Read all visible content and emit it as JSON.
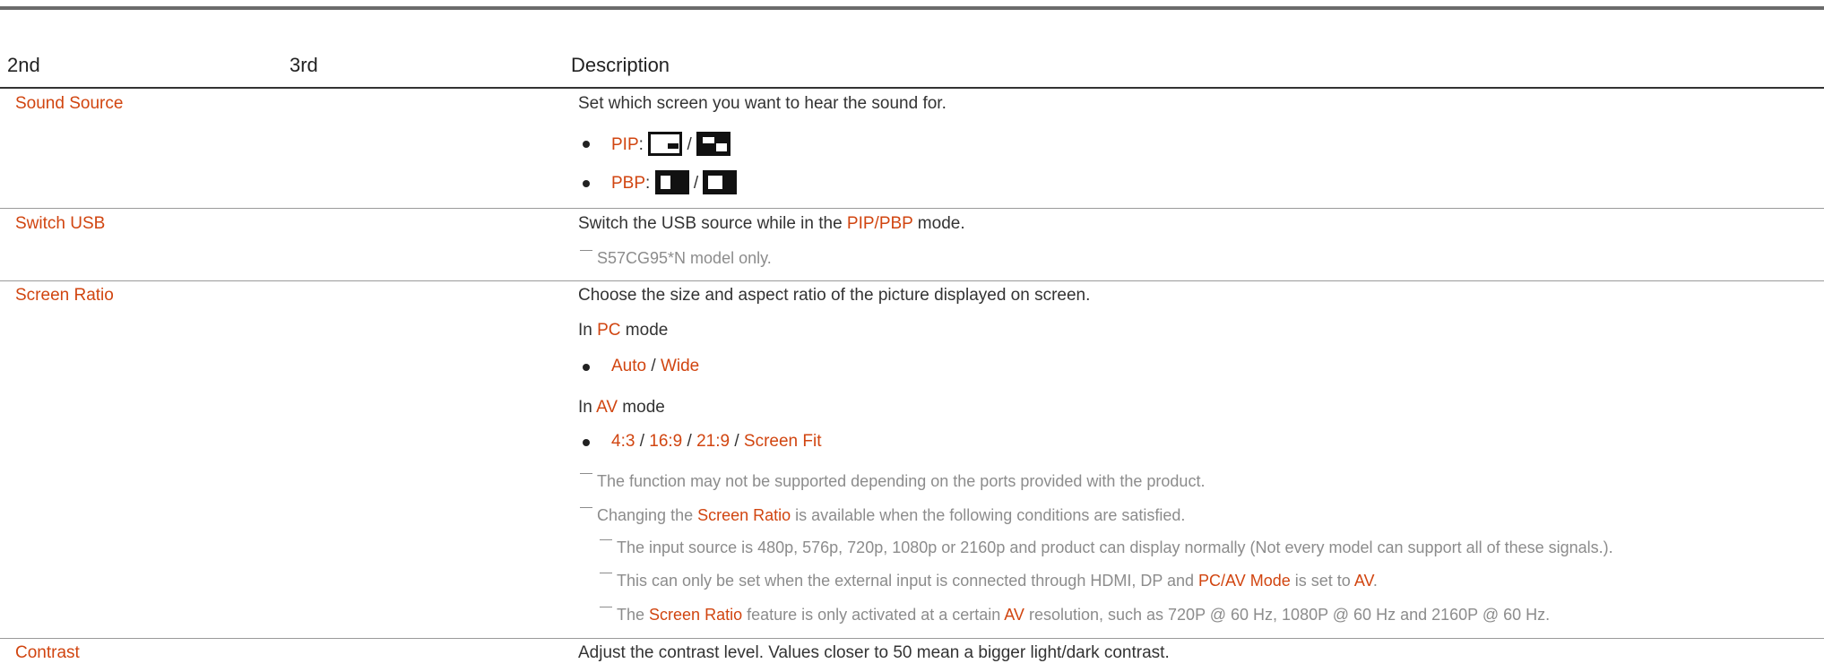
{
  "table": {
    "headers": {
      "col2": "2nd",
      "col3": "3rd",
      "desc": "Description"
    },
    "sound_source": {
      "label": "Sound Source",
      "desc": "Set which screen you want to hear the sound for.",
      "pip_label": "PIP",
      "pbp_label": "PBP",
      "colon": ":",
      "slash": "/",
      "icons": [
        "pip-small-window-icon",
        "pip-large-window-icon",
        "pbp-left-window-icon",
        "pbp-right-window-icon"
      ]
    },
    "switch_usb": {
      "label": "Switch USB",
      "desc_before": "Switch the USB source while in the ",
      "desc_mode": "PIP/PBP",
      "desc_after": " mode.",
      "note": "S57CG95*N model only."
    },
    "screen_ratio": {
      "label": "Screen Ratio",
      "desc": "Choose the size and aspect ratio of the picture displayed on screen.",
      "pc_in": "In ",
      "pc_mode_name": "PC",
      "pc_mode": " mode",
      "pc_options": [
        "Auto",
        "Wide"
      ],
      "av_in": "In ",
      "av_mode_name": "AV",
      "av_mode": " mode",
      "av_options": [
        "4:3",
        "16:9",
        "21:9",
        "Screen Fit"
      ],
      "note1": "The function may not be supported depending on the ports provided with the product.",
      "note2_before": "Changing the ",
      "note2_highlight": "Screen Ratio",
      "note2_after": " is available when the following conditions are satisfied.",
      "sub1": "The input source is 480p, 576p, 720p, 1080p or 2160p and product can display normally (Not every model can support all of these signals.).",
      "sub2_before": "This can only be set when the external input is connected through HDMI, DP and ",
      "sub2_highlight": "PC/AV Mode",
      "sub2_mid": " is set to ",
      "sub2_value": "AV",
      "sub2_end": ".",
      "sub3_before": "The ",
      "sub3_highlight": "Screen Ratio",
      "sub3_mid": " feature is only activated at a certain ",
      "sub3_av": "AV",
      "sub3_after": " resolution, such as 720P @ 60 Hz, 1080P @ 60 Hz and 2160P @ 60 Hz."
    },
    "contrast": {
      "label": "Contrast",
      "desc": "Adjust the contrast level. Values closer to 50 mean a bigger light/dark contrast."
    }
  },
  "colors": {
    "accent": "#d14510",
    "text": "#333333",
    "note": "#8c8c8c"
  }
}
